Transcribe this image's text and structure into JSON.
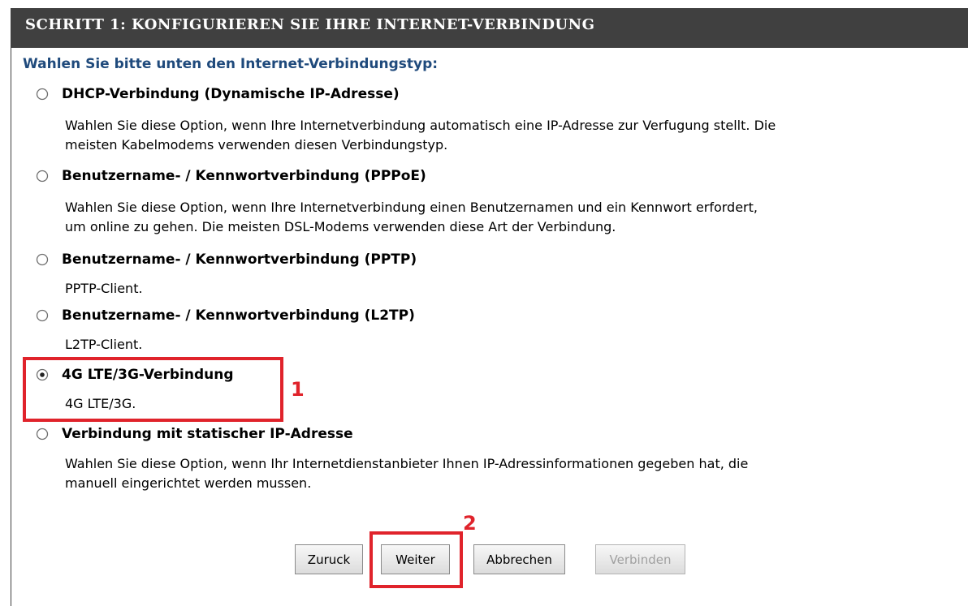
{
  "header": {
    "title": "SCHRITT 1: KONFIGURIEREN SIE IHRE INTERNET-VERBINDUNG"
  },
  "prompt": "Wahlen Sie bitte unten den Internet-Verbindungstyp:",
  "options": [
    {
      "label": "DHCP-Verbindung (Dynamische IP-Adresse)",
      "description": [
        "Wahlen Sie diese Option, wenn Ihre Internetverbindung automatisch eine IP-Adresse zur Verfugung stellt. Die",
        "meisten Kabelmodems verwenden diesen Verbindungstyp."
      ],
      "selected": false
    },
    {
      "label": "Benutzername- / Kennwortverbindung (PPPoE)",
      "description": [
        "Wahlen Sie diese Option, wenn Ihre Internetverbindung einen Benutzernamen und ein Kennwort erfordert,",
        "um online zu gehen. Die meisten DSL-Modems verwenden diese Art der Verbindung."
      ],
      "selected": false
    },
    {
      "label": "Benutzername- / Kennwortverbindung (PPTP)",
      "description": [
        "PPTP-Client."
      ],
      "selected": false
    },
    {
      "label": "Benutzername- / Kennwortverbindung (L2TP)",
      "description": [
        "L2TP-Client."
      ],
      "selected": false
    },
    {
      "label": "4G LTE/3G-Verbindung",
      "description": [
        "4G LTE/3G."
      ],
      "selected": true
    },
    {
      "label": "Verbindung mit statischer IP-Adresse",
      "description": [
        "Wahlen Sie diese Option, wenn Ihr Internetdienstanbieter Ihnen IP-Adressinformationen gegeben hat, die",
        "manuell eingerichtet werden mussen."
      ],
      "selected": false
    }
  ],
  "annotations": {
    "marker_1": "1",
    "marker_2": "2",
    "color": "#e0232b"
  },
  "buttons": {
    "back": "Zuruck",
    "next": "Weiter",
    "cancel": "Abbrechen",
    "connect": "Verbinden"
  },
  "colors": {
    "header_bg": "#404040",
    "prompt_text": "#1f4a7c"
  }
}
